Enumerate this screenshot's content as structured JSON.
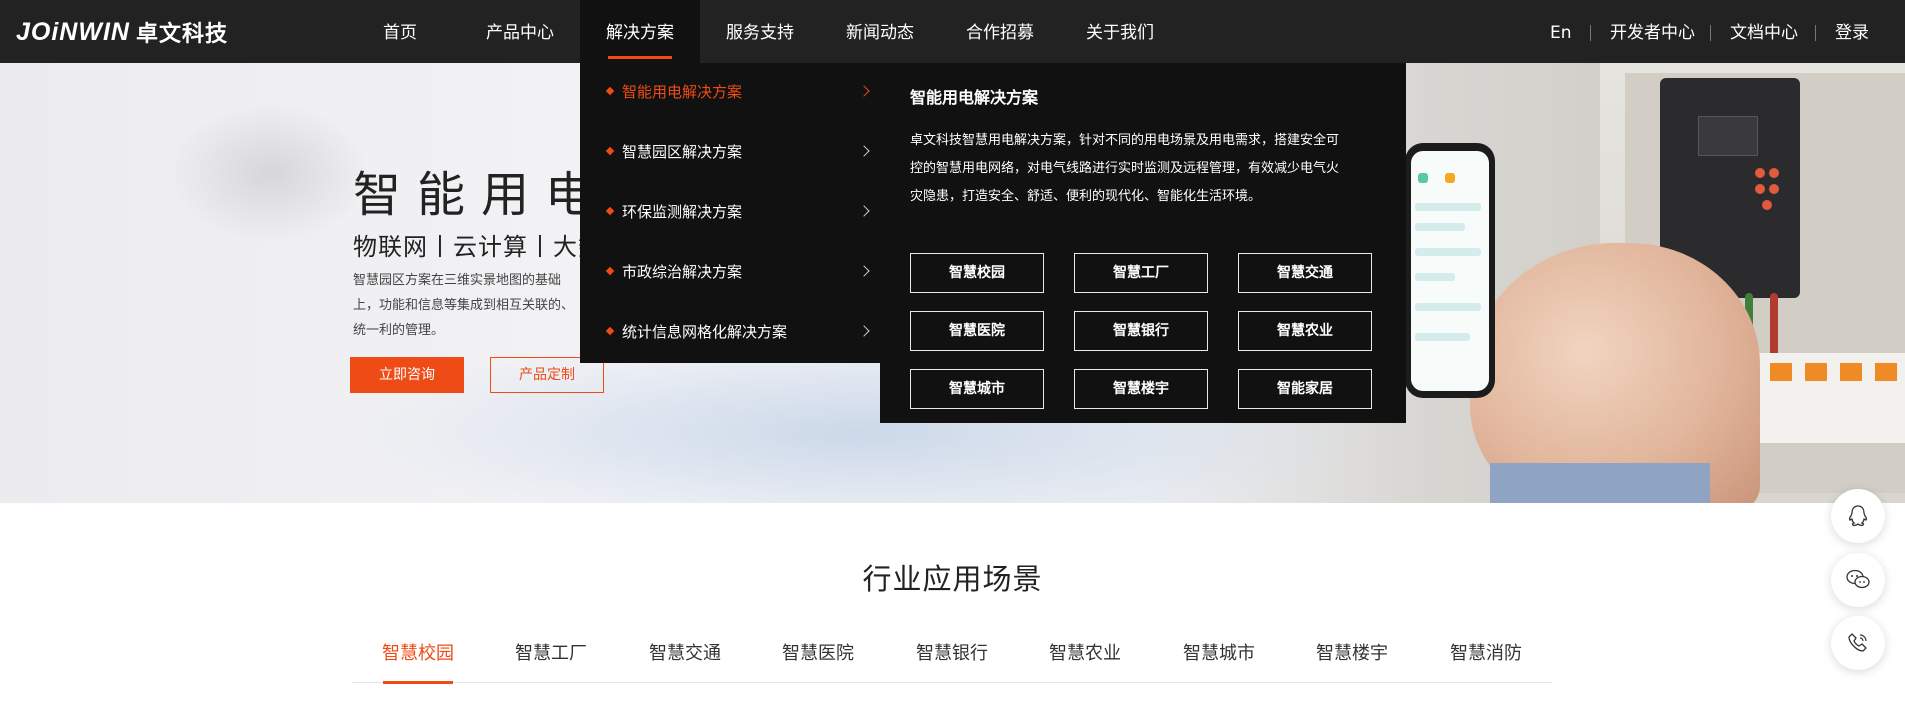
{
  "brand": {
    "logo_mark": "JOiNWIN",
    "logo_cn": "卓文科技",
    "accent_color": "#ee4b16",
    "nav_bg": "#222222"
  },
  "nav": {
    "items": [
      "首页",
      "产品中心",
      "解决方案",
      "服务支持",
      "新闻动态",
      "合作招募",
      "关于我们"
    ],
    "active": "解决方案",
    "right": [
      "En",
      "开发者中心",
      "文档中心",
      "登录"
    ]
  },
  "hero": {
    "title": "智能用电",
    "subtitle": "物联网丨云计算丨大数",
    "desc": "智慧园区方案在三维实景地图的基础上，功能和信息等集成到相互关联的、统一利的管理。",
    "btn_consult": "立即咨询",
    "btn_custom": "产品定制"
  },
  "solutions_menu": {
    "items": [
      "智能用电解决方案",
      "智慧园区解决方案",
      "环保监测解决方案",
      "市政综治解决方案",
      "统计信息网格化解决方案"
    ],
    "active": "智能用电解决方案",
    "detail": {
      "title": "智能用电解决方案",
      "desc": "卓文科技智慧用电解决方案，针对不同的用电场景及用电需求，搭建安全可控的智慧用电网络，对电气线路进行实时监测及远程管理，有效减少电气火灾隐患，打造安全、舒适、便利的现代化、智能化生活环境。",
      "tiles": [
        "智慧校园",
        "智慧工厂",
        "智慧交通",
        "智慧医院",
        "智慧银行",
        "智慧农业",
        "智慧城市",
        "智慧楼宇",
        "智能家居"
      ]
    }
  },
  "industry": {
    "title": "行业应用场景",
    "tabs": [
      "智慧校园",
      "智慧工厂",
      "智慧交通",
      "智慧医院",
      "智慧银行",
      "智慧农业",
      "智慧城市",
      "智慧楼宇",
      "智慧消防"
    ],
    "active": "智慧校园"
  },
  "float_buttons": [
    "qq-icon",
    "wechat-icon",
    "phone-icon"
  ]
}
